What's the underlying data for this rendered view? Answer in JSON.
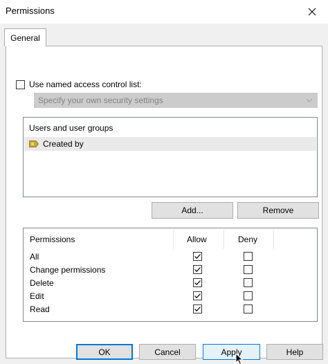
{
  "window": {
    "title": "Permissions"
  },
  "tabs": [
    {
      "label": "General"
    }
  ],
  "acl": {
    "checkbox_label": "Use named access control list:",
    "checked": false,
    "combo_value": "Specify your own security settings"
  },
  "users": {
    "header": "Users and user groups",
    "items": [
      {
        "label": "Created by"
      }
    ]
  },
  "buttons": {
    "add_label": "Add...",
    "remove_label": "Remove",
    "ok_label": "OK",
    "cancel_label": "Cancel",
    "apply_label": "Apply",
    "help_label": "Help"
  },
  "permissions": {
    "col_name": "Permissions",
    "col_allow": "Allow",
    "col_deny": "Deny",
    "rows": [
      {
        "name": "All",
        "allow": true,
        "deny": false
      },
      {
        "name": "Change permissions",
        "allow": true,
        "deny": false
      },
      {
        "name": "Delete",
        "allow": true,
        "deny": false
      },
      {
        "name": "Edit",
        "allow": true,
        "deny": false
      },
      {
        "name": "Read",
        "allow": true,
        "deny": false
      }
    ]
  },
  "colors": {
    "accent": "#0078d7",
    "tag_icon": "#c8a82c",
    "dialog_bg": "#f0f0f0",
    "button_bg": "#e1e1e1",
    "combo_bg": "#cccccc"
  },
  "icons": {
    "close": "close-icon",
    "tag": "tag-icon",
    "combo_arrow": "chevron-down-icon",
    "check": "checkmark-icon",
    "cursor": "mouse-cursor-icon"
  }
}
